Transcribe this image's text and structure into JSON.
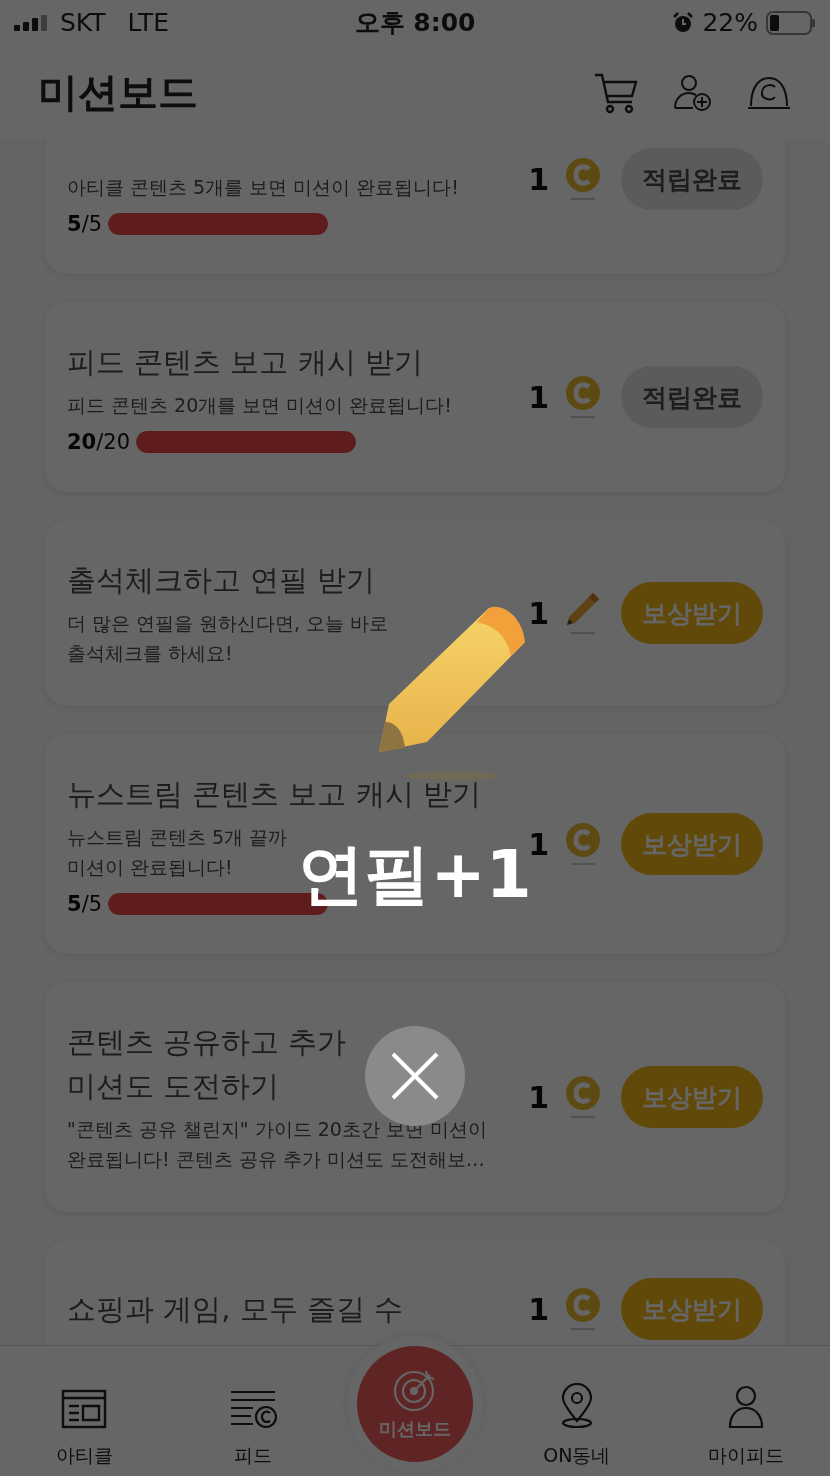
{
  "status_bar": {
    "carrier": "SKT",
    "network": "LTE",
    "time": "오후 8:00",
    "battery": "22%"
  },
  "header": {
    "title": "미션보드"
  },
  "missions": [
    {
      "description": "아티클 콘텐츠 5개를 보면 미션이 완료됩니다!",
      "progress": {
        "current": "5",
        "total": "/5",
        "level": 1
      },
      "reward_count": "1",
      "kind": "coin",
      "button": "적립완료",
      "claimed": true
    },
    {
      "title": "피드 콘텐츠 보고 캐시 받기",
      "description": "피드 콘텐츠 20개를 보면 미션이 완료됩니다!",
      "progress": {
        "current": "20",
        "total": "/20",
        "level": 1
      },
      "reward_count": "1",
      "kind": "coin",
      "button": "적립완료",
      "claimed": true
    },
    {
      "title": "출석체크하고 연필 받기",
      "description": "더 많은 연필을 원하신다면, 오늘 바로\n출석체크를 하세요!",
      "reward_count": "1",
      "kind": "pencil",
      "button": "보상받기",
      "claimed": false
    },
    {
      "title": "뉴스트림 콘텐츠 보고 캐시 받기",
      "description": "뉴스트림 콘텐츠 5개 끝까\n미션이 완료됩니다!",
      "progress": {
        "current": "5",
        "total": "/5",
        "level": 1
      },
      "reward_count": "1",
      "kind": "coin",
      "button": "보상받기",
      "claimed": false
    },
    {
      "title": "콘텐츠 공유하고 추가\n미션도 도전하기",
      "description": "\"콘텐츠 공유 챌린지\" 가이드 20초간 보면 미션이\n완료됩니다! 콘텐츠 공유 추가 미션도 도전해보…",
      "reward_count": "1",
      "kind": "coin",
      "button": "보상받기",
      "claimed": false
    },
    {
      "title": "쇼핑과 게임, 모두 즐길 수",
      "reward_count": "1",
      "kind": "coin",
      "button": "보상받기",
      "claimed": false
    }
  ],
  "bottom_nav": [
    {
      "label": "아티클",
      "selected": false
    },
    {
      "label": "피드",
      "selected": false
    },
    {
      "label": "미션보드",
      "selected": true
    },
    {
      "label": "ON동네",
      "selected": false
    },
    {
      "label": "마이피드",
      "selected": false
    }
  ],
  "popup": {
    "message": "연필+1"
  }
}
